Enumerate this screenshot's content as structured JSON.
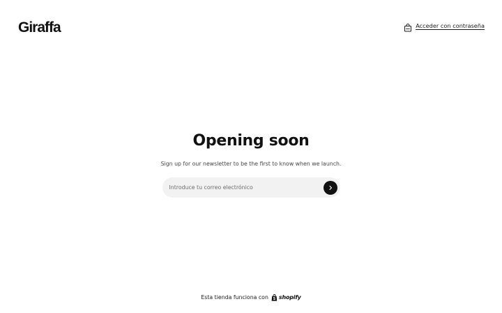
{
  "header": {
    "logo_text": "Giraffa",
    "password_link_label": "Acceder con contraseña",
    "password_icon": "shopping-bag-icon"
  },
  "main": {
    "heading": "Opening soon",
    "subtext": "Sign up for our newsletter to be the first to know when we launch.",
    "email_placeholder": "Introduce tu correo electrónico",
    "email_value": "",
    "submit_icon": "chevron-right-icon"
  },
  "footer": {
    "powered_by": "Esta tienda funciona con",
    "shopify_label": "shopify",
    "shopify_icon": "shopify-bag-icon"
  },
  "colors": {
    "background": "#ffffff",
    "text": "#1a1a1a",
    "input_bg": "#f2f2f2",
    "button_bg": "#111111"
  }
}
